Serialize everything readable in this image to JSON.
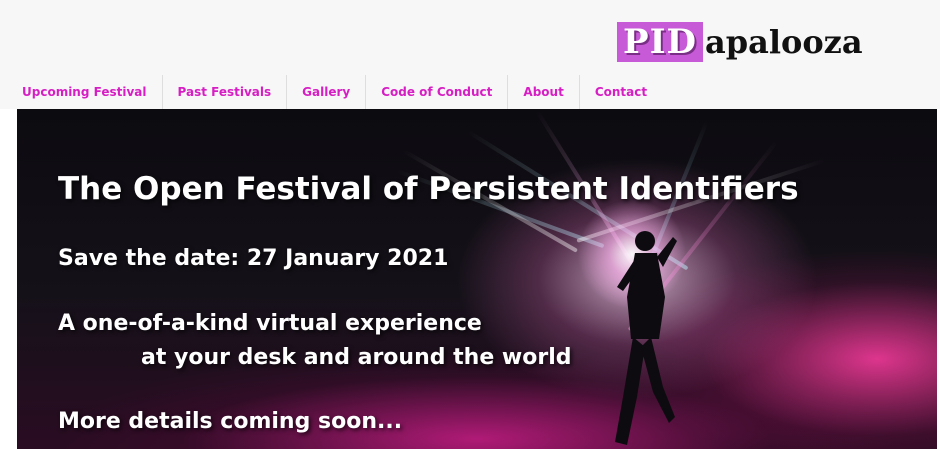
{
  "header": {
    "logo_highlight": "PID",
    "logo_rest": "apalooza"
  },
  "nav": {
    "items": [
      {
        "label": "Upcoming Festival"
      },
      {
        "label": "Past Festivals"
      },
      {
        "label": "Gallery"
      },
      {
        "label": "Code of Conduct"
      },
      {
        "label": "About"
      },
      {
        "label": "Contact"
      }
    ]
  },
  "hero": {
    "headline": "The Open Festival of Persistent Identifiers",
    "save_date": "Save the date: 27 January 2021",
    "experience_line1": "A one-of-a-kind virtual experience",
    "experience_line2": "at your desk and around the world",
    "details": "More details coming soon..."
  },
  "colors": {
    "accent": "#d61ec4",
    "logo_box": "#c75ad6",
    "band_background": "#f8f7f7"
  },
  "icons": {
    "hero_image": "dance-floor-lights-photo"
  }
}
